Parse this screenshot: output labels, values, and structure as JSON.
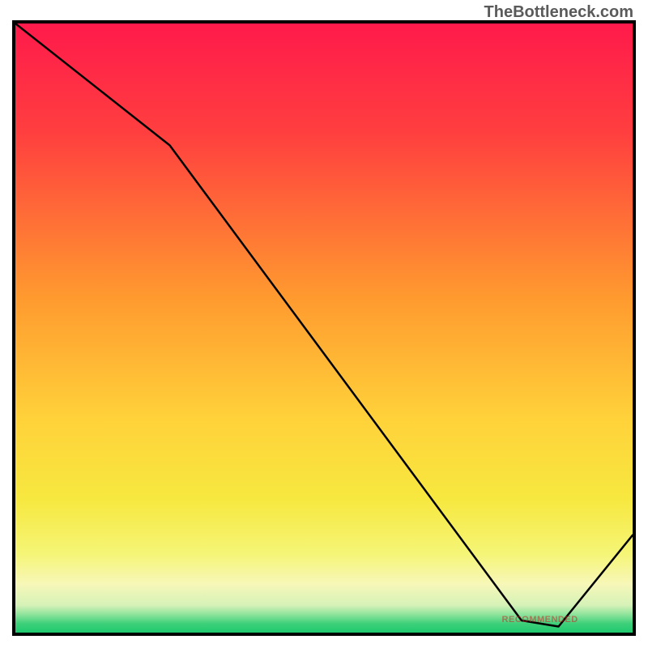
{
  "watermark": "TheBottleneck.com",
  "bottom_label": "RECOMMENDED",
  "chart_data": {
    "type": "line",
    "title": "",
    "xlabel": "",
    "ylabel": "",
    "xlim": [
      0,
      100
    ],
    "ylim": [
      0,
      100
    ],
    "x": [
      0,
      25,
      82,
      88,
      100
    ],
    "values": [
      100,
      80,
      2,
      1,
      16
    ],
    "gradient_stops": [
      {
        "pos": 0,
        "color": "#ff1a4b"
      },
      {
        "pos": 18,
        "color": "#ff3f3f"
      },
      {
        "pos": 45,
        "color": "#ff9a2f"
      },
      {
        "pos": 65,
        "color": "#ffd23a"
      },
      {
        "pos": 78,
        "color": "#f7e83f"
      },
      {
        "pos": 87,
        "color": "#f5f576"
      },
      {
        "pos": 92,
        "color": "#f7f7b8"
      },
      {
        "pos": 95.5,
        "color": "#d6f2b8"
      },
      {
        "pos": 97,
        "color": "#8fe49c"
      },
      {
        "pos": 98.5,
        "color": "#3ed07a"
      },
      {
        "pos": 100,
        "color": "#1fc96e"
      }
    ]
  },
  "plot": {
    "viewbox_w": 762,
    "viewbox_h": 752
  }
}
